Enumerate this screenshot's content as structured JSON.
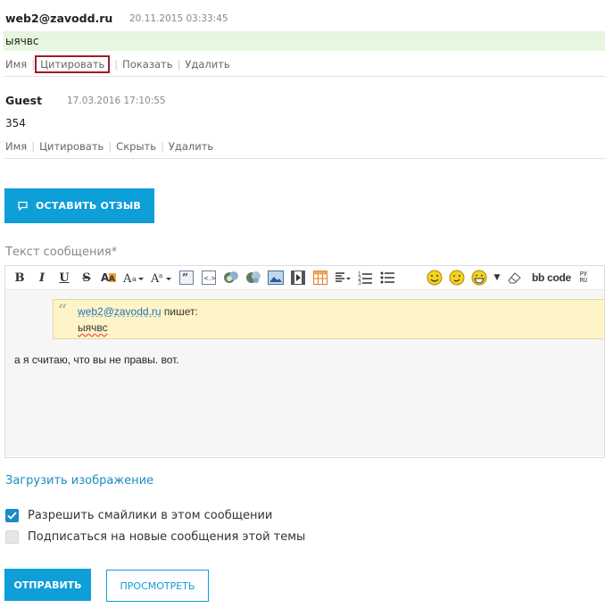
{
  "comments": [
    {
      "author": "web2@zavodd.ru",
      "date": "20.11.2015 03:33:45",
      "text": "ыячвс",
      "highlight_color": "#e6f6df",
      "actions": [
        "Имя",
        "Цитировать",
        "Показать",
        "Удалить"
      ]
    },
    {
      "author": "Guest",
      "date": "17.03.2016 17:10:55",
      "text": "354",
      "actions": [
        "Имя",
        "Цитировать",
        "Скрыть",
        "Удалить"
      ]
    }
  ],
  "review_button": {
    "label": "ОСТАВИТЬ ОТЗЫВ",
    "icon": "comment-icon"
  },
  "form": {
    "message_label": "Текст сообщения*",
    "toolbar": {
      "buttons": [
        "bold",
        "italic",
        "underline",
        "strikethrough",
        "font-color",
        "font-size",
        "font-family",
        "quote",
        "code",
        "insert-link",
        "delete-link",
        "insert-image",
        "insert-video",
        "insert-table",
        "align",
        "ordered-list",
        "unordered-list",
        "smile-1",
        "smile-2",
        "smile-3",
        "smiles-more",
        "remove-format"
      ],
      "bbcode_label": "bb code",
      "translit_label": "РУ RU"
    },
    "editor": {
      "quote_author": "web2@zavodd.ru",
      "quote_writes": " пишет:",
      "quote_text": "ыячвс",
      "message_text": "а я считаю, что вы не правы. вот."
    },
    "upload_link": "Загрузить изображение",
    "checkboxes": [
      {
        "label": "Разрешить смайлики в этом сообщении",
        "checked": true
      },
      {
        "label": "Подписаться на новые сообщения этой темы",
        "checked": false
      }
    ],
    "send_label": "ОТПРАВИТЬ",
    "preview_label": "ПРОСМОТРЕТЬ"
  },
  "colors": {
    "accent": "#0e9ed8",
    "link": "#1b8bc5",
    "quote_bg": "#fff4c7",
    "highlight": "#e6f6df",
    "focus_border": "#a01c20"
  }
}
